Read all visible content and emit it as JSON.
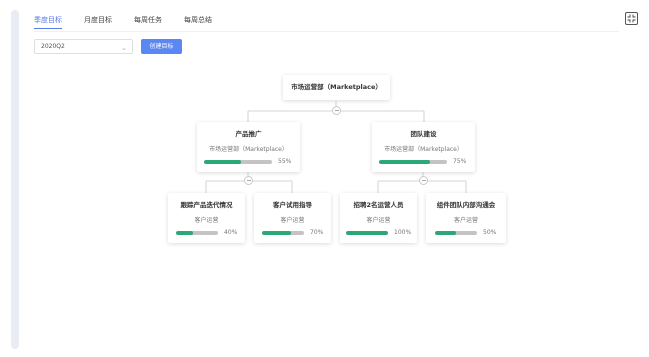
{
  "tabs": [
    {
      "label": "季度目标",
      "active": true
    },
    {
      "label": "月度目标",
      "active": false
    },
    {
      "label": "每周任务",
      "active": false
    },
    {
      "label": "每周总结",
      "active": false
    }
  ],
  "filter": {
    "quarter": "2020Q2"
  },
  "create_button_label": "创建目标",
  "tree": {
    "root": {
      "title": "市场运营部（Marketplace）"
    },
    "level1": [
      {
        "title": "产品推广",
        "dept": "市场运营部（Marketplace）",
        "progress": 55,
        "progress_label": "55%"
      },
      {
        "title": "团队建设",
        "dept": "市场运营部（Marketplace）",
        "progress": 75,
        "progress_label": "75%"
      }
    ],
    "level2": [
      {
        "title": "跟踪产品迭代情况",
        "dept": "客户运营",
        "progress": 40,
        "progress_label": "40%"
      },
      {
        "title": "客户试用指导",
        "dept": "客户运营",
        "progress": 70,
        "progress_label": "70%"
      },
      {
        "title": "招聘2名运营人员",
        "dept": "客户运营",
        "progress": 100,
        "progress_label": "100%"
      },
      {
        "title": "组件团队内部沟通会",
        "dept": "客户运营",
        "progress": 50,
        "progress_label": "50%"
      }
    ]
  },
  "colors": {
    "accent": "#5b7be9",
    "button": "#5b87f2",
    "progress": "#2ca878",
    "track": "#c4c4c4"
  }
}
